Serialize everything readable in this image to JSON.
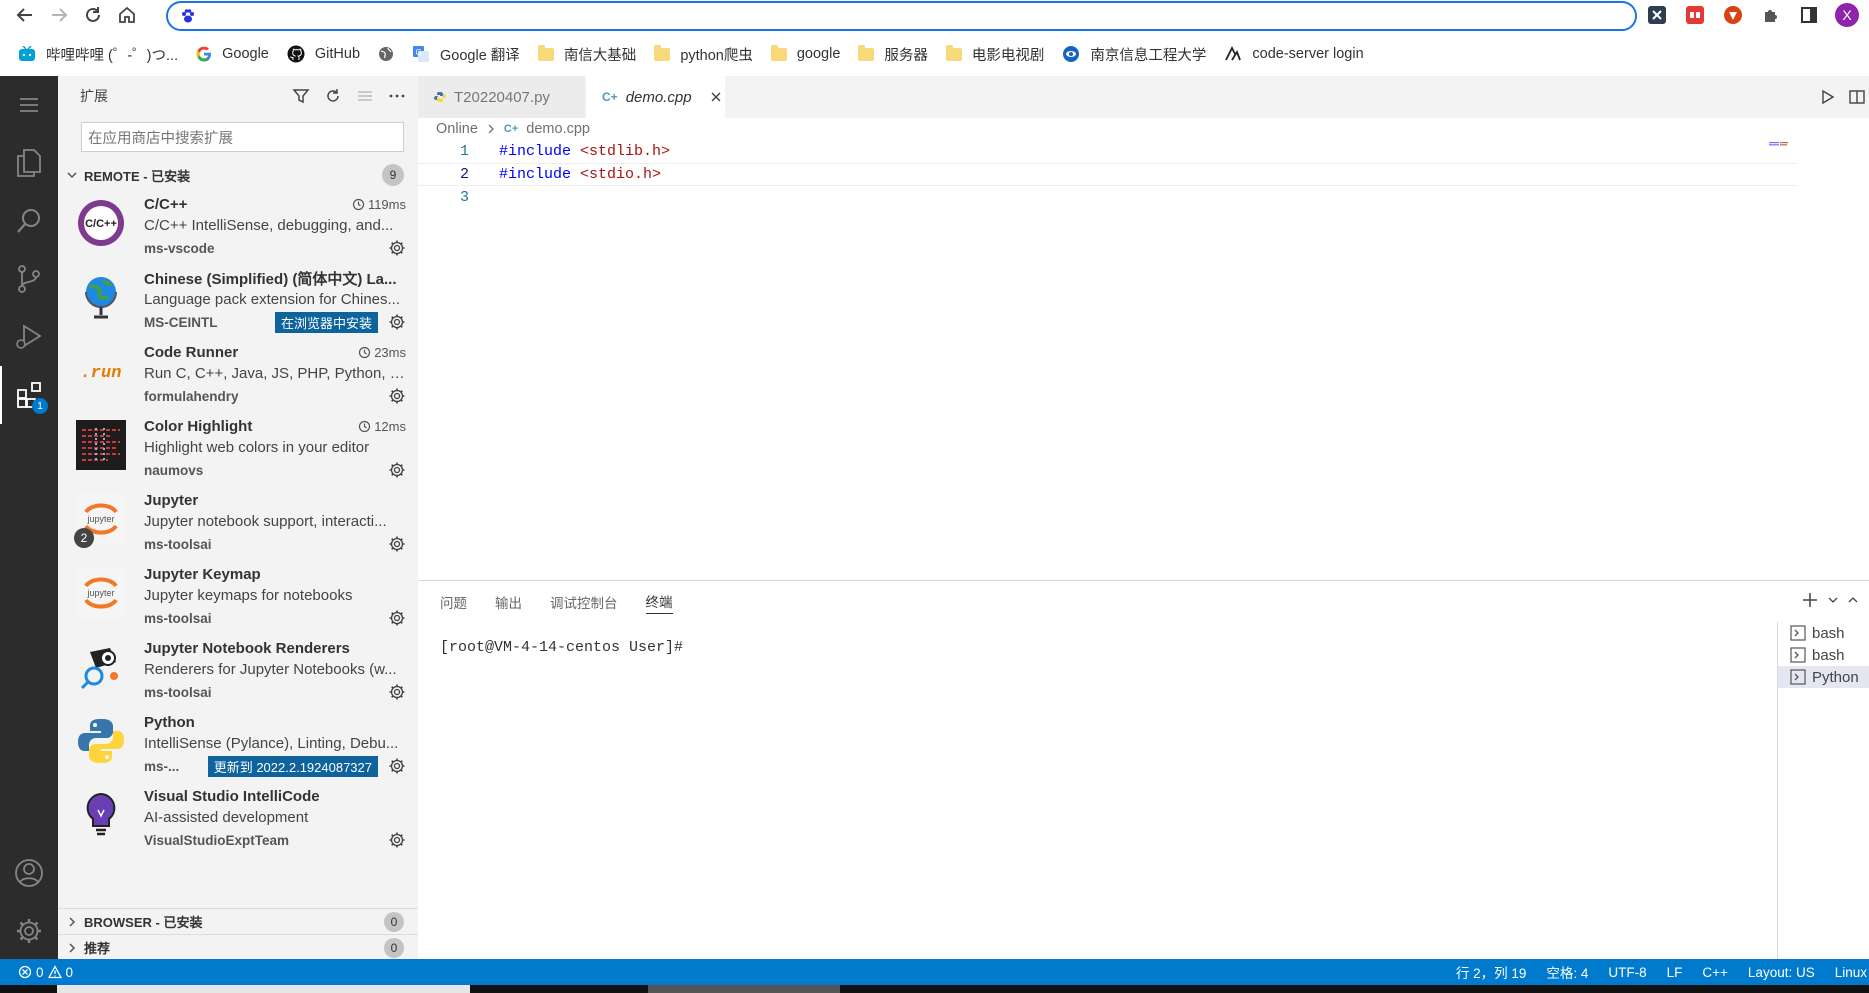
{
  "browser": {
    "bookmarks": [
      {
        "label": "哔哩哔哩 (゜-゜)つ...",
        "icon": "bilibili-icon"
      },
      {
        "label": "Google",
        "icon": "google-icon"
      },
      {
        "label": "GitHub",
        "icon": "github-icon"
      },
      {
        "label": "",
        "icon": "globe-icon"
      },
      {
        "label": "Google 翻译",
        "icon": "translate-icon"
      },
      {
        "label": "南信大基础",
        "icon": "folder-icon"
      },
      {
        "label": "python爬虫",
        "icon": "folder-icon"
      },
      {
        "label": "google",
        "icon": "folder-icon"
      },
      {
        "label": "服务器",
        "icon": "folder-icon"
      },
      {
        "label": "电影电视剧",
        "icon": "folder-icon"
      },
      {
        "label": "南京信息工程大学",
        "icon": "university-icon"
      },
      {
        "label": "code-server login",
        "icon": "code-server-icon"
      }
    ],
    "profile_initial": "X",
    "accent": "#1a73e8"
  },
  "activitybar": {
    "extensions_badge": "1"
  },
  "sidebar": {
    "title": "扩展",
    "search_placeholder": "在应用商店中搜索扩展",
    "remote_section": {
      "label": "REMOTE - 已安装",
      "count": "9"
    },
    "extensions": [
      {
        "name": "C/C++",
        "desc": "C/C++ IntelliSense, debugging, and...",
        "publisher": "ms-vscode",
        "time": "119ms",
        "action": "",
        "badge": ""
      },
      {
        "name": "Chinese (Simplified) (简体中文) La...",
        "desc": "Language pack extension for Chines...",
        "publisher": "MS-CEINTL",
        "time": "",
        "action": "在浏览器中安装",
        "badge": ""
      },
      {
        "name": "Code Runner",
        "desc": "Run C, C++, Java, JS, PHP, Python, P...",
        "publisher": "formulahendry",
        "time": "23ms",
        "action": "",
        "badge": ""
      },
      {
        "name": "Color Highlight",
        "desc": "Highlight web colors in your editor",
        "publisher": "naumovs",
        "time": "12ms",
        "action": "",
        "badge": ""
      },
      {
        "name": "Jupyter",
        "desc": "Jupyter notebook support, interacti...",
        "publisher": "ms-toolsai",
        "time": "",
        "action": "",
        "badge": "2"
      },
      {
        "name": "Jupyter Keymap",
        "desc": "Jupyter keymaps for notebooks",
        "publisher": "ms-toolsai",
        "time": "",
        "action": "",
        "badge": ""
      },
      {
        "name": "Jupyter Notebook Renderers",
        "desc": "Renderers for Jupyter Notebooks (w...",
        "publisher": "ms-toolsai",
        "time": "",
        "action": "",
        "badge": ""
      },
      {
        "name": "Python",
        "desc": "IntelliSense (Pylance), Linting, Debu...",
        "publisher": "ms-...",
        "time": "",
        "action": "更新到 2022.2.1924087327",
        "badge": ""
      },
      {
        "name": "Visual Studio IntelliCode",
        "desc": "AI-assisted development",
        "publisher": "VisualStudioExptTeam",
        "time": "",
        "action": "",
        "badge": ""
      }
    ],
    "browser_section": {
      "label": "BROWSER - 已安装",
      "count": "0"
    },
    "recommended_section": {
      "label": "推荐",
      "count": "0"
    }
  },
  "editor": {
    "tabs": [
      {
        "label": "T20220407.py",
        "active": false
      },
      {
        "label": "demo.cpp",
        "active": true
      }
    ],
    "breadcrumb": [
      "Online",
      "demo.cpp"
    ],
    "lines": [
      {
        "num": "1",
        "kw": "#include",
        "str": "<stdlib.h>"
      },
      {
        "num": "2",
        "kw": "#include",
        "str": "<stdio.h>"
      },
      {
        "num": "3",
        "kw": "",
        "str": ""
      }
    ]
  },
  "panel": {
    "tabs": [
      "问题",
      "输出",
      "调试控制台",
      "终端"
    ],
    "active_tab": "终端",
    "prompt": "[root@VM-4-14-centos User]#",
    "terminals": [
      "bash",
      "bash",
      "Python"
    ]
  },
  "statusbar": {
    "errors": "0",
    "warnings": "0",
    "cursor": "行 2，列 19",
    "spaces": "空格: 4",
    "encoding": "UTF-8",
    "eol": "LF",
    "language": "C++",
    "layout": "Layout: US",
    "platform": "Linux",
    "color": "#007acc"
  }
}
